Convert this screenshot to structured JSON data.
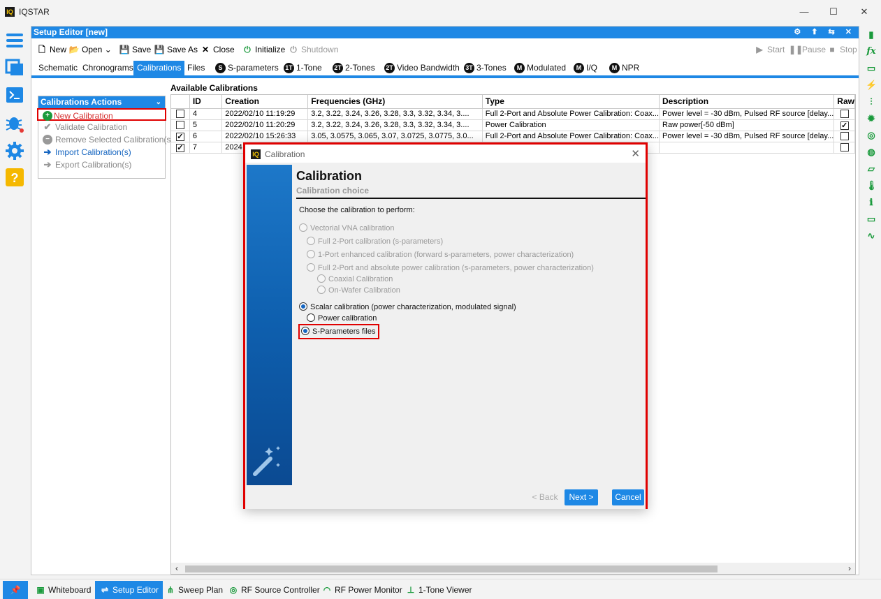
{
  "app": {
    "logo_text": "IQ",
    "title": "IQSTAR"
  },
  "window_controls": {
    "minimize": "—",
    "maximize": "☐",
    "close": "✕"
  },
  "left_sidebar": {
    "icons": [
      "menu-icon",
      "files-icon",
      "terminal-icon",
      "bug-icon",
      "gear-icon",
      "help-icon"
    ]
  },
  "right_sidebar": {
    "icons": [
      "calculator-icon",
      "function-icon",
      "drive-icon",
      "bolt-icon",
      "sliders-icon",
      "chip-icon",
      "target-icon",
      "globe-icon",
      "box-icon",
      "thermometer-icon",
      "thermometer-settings-icon",
      "monitor-icon",
      "waveform-icon"
    ]
  },
  "editor": {
    "header_title": "Setup Editor [new]",
    "header_icons": "⚙ ⬆ ⇆ ✕"
  },
  "toolbar": {
    "new": "New",
    "open": "Open",
    "save": "Save",
    "save_as": "Save As",
    "close": "Close",
    "initialize": "Initialize",
    "shutdown": "Shutdown",
    "start": "Start",
    "pause": "Pause",
    "stop": "Stop"
  },
  "tabs": [
    {
      "label": "Schematic",
      "badge": ""
    },
    {
      "label": "Chronograms",
      "badge": ""
    },
    {
      "label": "Calibrations",
      "badge": ""
    },
    {
      "label": "Files",
      "badge": ""
    },
    {
      "label": "S-parameters",
      "badge": "S"
    },
    {
      "label": "1-Tone",
      "badge": "1T"
    },
    {
      "label": "2-Tones",
      "badge": "2T"
    },
    {
      "label": "Video Bandwidth",
      "badge": "2T"
    },
    {
      "label": "3-Tones",
      "badge": "3T"
    },
    {
      "label": "Modulated",
      "badge": "M"
    },
    {
      "label": "I/Q",
      "badge": "M"
    },
    {
      "label": "NPR",
      "badge": "M"
    }
  ],
  "actions": {
    "title": "Calibrations Actions",
    "items": [
      {
        "label": "New Calibration",
        "state": "highlighted"
      },
      {
        "label": "Validate Calibration",
        "state": "disabled"
      },
      {
        "label": "Remove Selected Calibration(s)",
        "state": "disabled"
      },
      {
        "label": "Import Calibration(s)",
        "state": "enabled"
      },
      {
        "label": "Export Calibration(s)",
        "state": "disabled"
      }
    ]
  },
  "calibrations": {
    "title": "Available Calibrations",
    "columns": [
      "ID",
      "Creation",
      "Frequencies (GHz)",
      "Type",
      "Description",
      "Raw"
    ],
    "rows": [
      {
        "selected": false,
        "id": "4",
        "creation": "2022/02/10 11:19:29",
        "frequencies": "3.2, 3.22, 3.24, 3.26, 3.28, 3.3, 3.32, 3.34, 3....",
        "type": "Full 2-Port and Absolute Power Calibration: Coax...",
        "description": "Power level = -30 dBm, Pulsed RF source [delay...",
        "raw": false
      },
      {
        "selected": false,
        "id": "5",
        "creation": "2022/02/10 11:20:29",
        "frequencies": "3.2, 3.22, 3.24, 3.26, 3.28, 3.3, 3.32, 3.34, 3....",
        "type": "Power Calibration",
        "description": "Raw power[-50 dBm]",
        "raw": true
      },
      {
        "selected": true,
        "id": "6",
        "creation": "2022/02/10 15:26:33",
        "frequencies": "3.05, 3.0575, 3.065, 3.07, 3.0725, 3.0775, 3.0...",
        "type": "Full 2-Port and Absolute Power Calibration: Coax...",
        "description": "Power level = -30 dBm, Pulsed RF source [delay...",
        "raw": false
      },
      {
        "selected": true,
        "id": "7",
        "creation": "2024",
        "frequencies": "",
        "type": "",
        "description": "",
        "raw": false
      }
    ]
  },
  "bottom_tabs": [
    {
      "label": "Whiteboard",
      "active": false
    },
    {
      "label": "Setup Editor",
      "active": true
    },
    {
      "label": "Sweep Plan",
      "active": false
    },
    {
      "label": "RF Source Controller",
      "active": false
    },
    {
      "label": "RF Power Monitor",
      "active": false
    },
    {
      "label": "1-Tone Viewer",
      "active": false
    }
  ],
  "dialog": {
    "logo_text": "IQ",
    "window_title": "Calibration",
    "heading": "Calibration",
    "subheading": "Calibration choice",
    "prompt": "Choose the calibration to perform:",
    "options": {
      "vna": "Vectorial VNA calibration",
      "full2port": "Full 2-Port calibration (s-parameters)",
      "oneport": "1-Port enhanced calibration (forward s-parameters, power characterization)",
      "full2port_abs": "Full 2-Port and absolute power calibration (s-parameters, power characterization)",
      "coaxial": "Coaxial Calibration",
      "onwafer": "On-Wafer Calibration",
      "scalar": "Scalar calibration (power characterization, modulated signal)",
      "power": "Power calibration",
      "sparam_files": "S-Parameters files"
    },
    "selected_option": "S-Parameters files",
    "buttons": {
      "back": "< Back",
      "next": "Next >",
      "cancel": "Cancel"
    }
  },
  "colors": {
    "accent": "#1e88e5",
    "highlight": "#e00000",
    "icon_green": "#1a9a3c"
  }
}
